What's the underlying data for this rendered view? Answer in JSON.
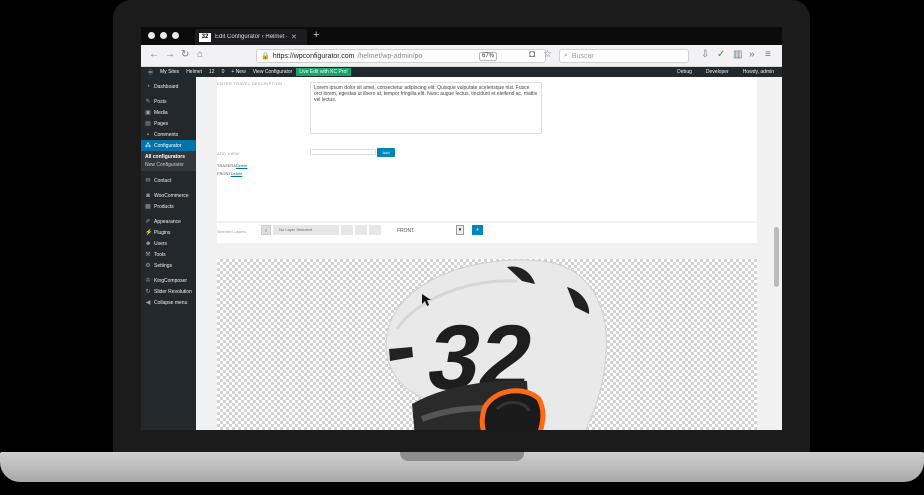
{
  "browser": {
    "tab_title": "Edit Configurator ‹ Helmet — W",
    "tab_logo": "32",
    "url_host": "https://wpconfigurator.com",
    "url_path": "/helmet/wp-admin/po",
    "zoom": "67%",
    "search_placeholder": "Buscar"
  },
  "adminbar": {
    "items": [
      "My Sites",
      "Helmet",
      "12",
      "0",
      "+ New",
      "View Configurator"
    ],
    "live": "Live Edit with KC Pro!",
    "right": [
      "Debug",
      "Developer",
      "Howdy, admin"
    ]
  },
  "sidebar": {
    "items": [
      "Dashboard",
      "Posts",
      "Media",
      "Pages",
      "Comments",
      "Configurator"
    ],
    "sub": [
      "All configurators",
      "New Configurator"
    ],
    "items2": [
      "Contact",
      "WooCommerce",
      "Products",
      "Appearance",
      "Plugins",
      "Users",
      "Tools",
      "Settings",
      "KingComposer",
      "Slider Revolution",
      "Collapse menu"
    ]
  },
  "editor": {
    "desc_label": "ENTER TRAVEL DESCRIPTION",
    "desc_text": "Lorem ipsum dolor sit amet, consectetur adipiscing elit. Quisque vulputate scelerisque nisi. Fusce orci lorem, egestas ut libero at, tempor fringilla elit. Nunc augue lectus, tincidunt et eleifend ac, mattis vel lectus.",
    "add_view_label": "ADD VIEW",
    "add_button": "Add",
    "view1": "TRASERA",
    "view1_link": "Delete",
    "view2": "FRONT",
    "view2_link": "Delete"
  },
  "layers": {
    "label": "Selected Layers",
    "selected": "No Layer Selected",
    "view": "FRONT",
    "drop": "▾",
    "btn": "+"
  },
  "helmet": {
    "number": "32"
  }
}
